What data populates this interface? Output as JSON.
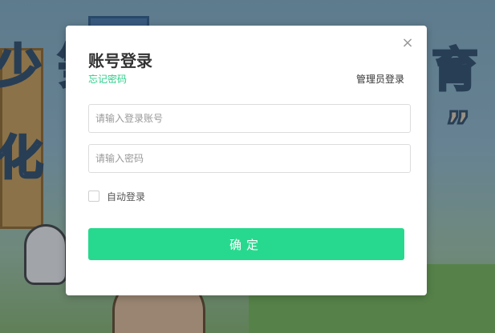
{
  "background": {
    "decor_text_left": "少 笋",
    "decor_text_left2": "化",
    "decor_text_right": "育",
    "decor_quote": "”"
  },
  "dialog": {
    "title": "账号登录",
    "close_icon": "×",
    "forgot_password_link": "忘记密码",
    "admin_login_link": "管理员登录",
    "account_input": {
      "value": "",
      "placeholder": "请输入登录账号"
    },
    "password_input": {
      "value": "",
      "placeholder": "请输入密码"
    },
    "remember_me": {
      "label": "自动登录",
      "checked": false
    },
    "submit_label": "确定"
  },
  "colors": {
    "accent": "#27d98e",
    "link": "#2bcf8a"
  }
}
